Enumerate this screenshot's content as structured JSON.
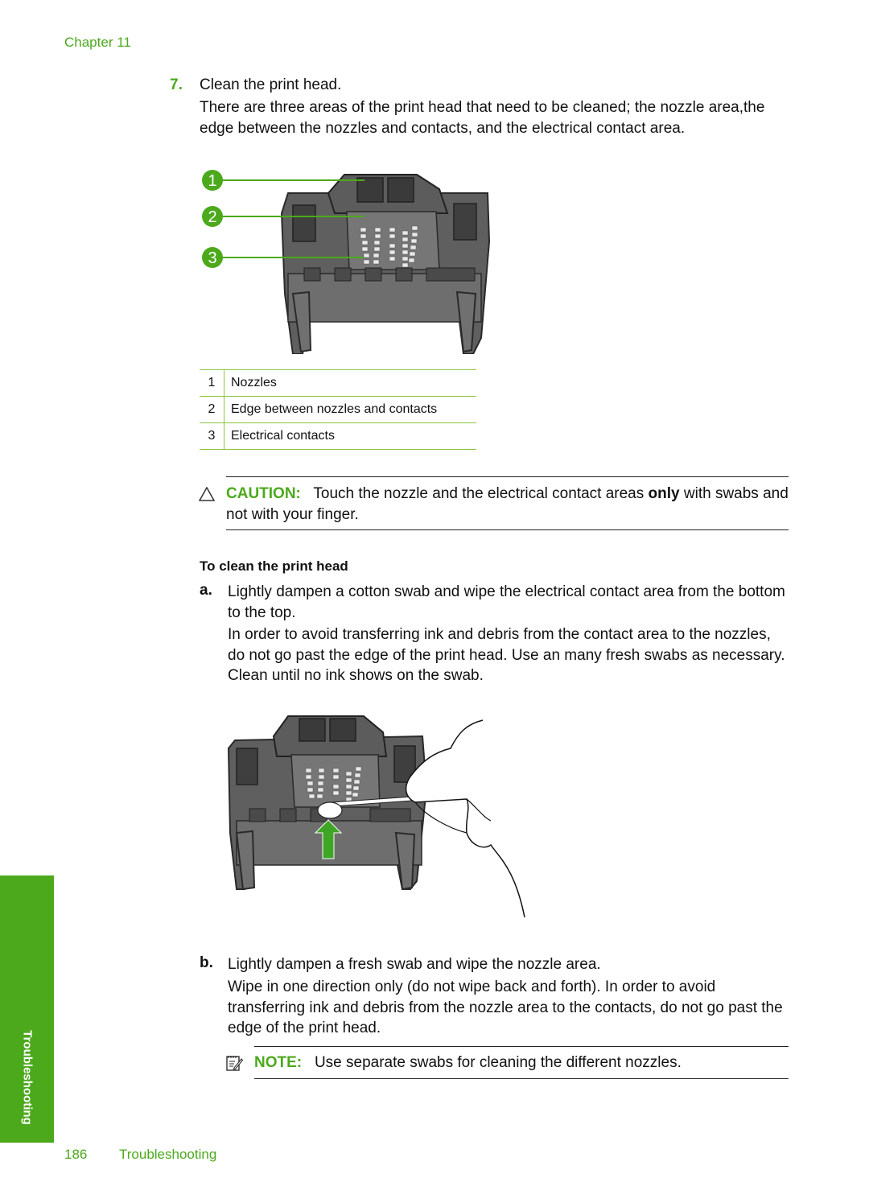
{
  "header": {
    "chapter": "Chapter 11"
  },
  "step": {
    "number": "7.",
    "title": "Clean the print head.",
    "description": "There are three areas of the print head that need to be cleaned; the nozzle area,the edge between the nozzles and contacts, and the electrical contact area."
  },
  "figure1": {
    "callouts": [
      "1",
      "2",
      "3"
    ]
  },
  "legend": [
    {
      "num": "1",
      "label": "Nozzles"
    },
    {
      "num": "2",
      "label": "Edge between nozzles and contacts"
    },
    {
      "num": "3",
      "label": "Electrical contacts"
    }
  ],
  "caution": {
    "icon": "caution-triangle-icon",
    "label": "CAUTION:",
    "text_before": "Touch the nozzle and the electrical contact areas ",
    "text_bold": "only",
    "text_after": " with swabs and not with your finger."
  },
  "procedure": {
    "heading": "To clean the print head",
    "items": [
      {
        "letter": "a.",
        "lead": "Lightly dampen a cotton swab and wipe the electrical contact area from the bottom to the top.",
        "detail": "In order to avoid transferring ink and debris from the contact area to the nozzles, do not go past the edge of the print head. Use an many fresh swabs as necessary. Clean until no ink shows on the swab."
      },
      {
        "letter": "b.",
        "lead": "Lightly dampen a fresh swab and wipe the nozzle area.",
        "detail": "Wipe in one direction only (do not wipe back and forth). In order to avoid transferring ink and debris from the nozzle area to the contacts, do not go past the edge of the print head."
      }
    ]
  },
  "note": {
    "icon": "note-pencil-icon",
    "label": "NOTE:",
    "text": "Use separate swabs for cleaning the different nozzles."
  },
  "side_tab": {
    "label": "Troubleshooting"
  },
  "footer": {
    "page": "186",
    "section": "Troubleshooting"
  },
  "colors": {
    "accent_green": "#4ca91c",
    "rule_green": "#8cc63f",
    "printhead_gray": "#6b6b6b"
  }
}
